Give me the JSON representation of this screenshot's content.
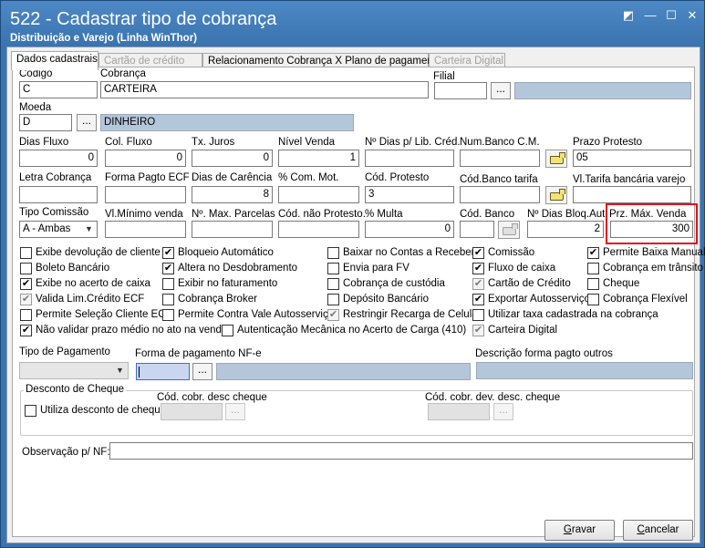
{
  "window": {
    "title": "522 - Cadastrar tipo de cobrança",
    "subtitle": "Distribuição e Varejo (Linha WinThor)"
  },
  "tabs": [
    {
      "label": "Dados cadastrais",
      "active": true
    },
    {
      "label": "Cartão de crédito",
      "enabled": false
    },
    {
      "label": "Relacionamento Cobrança X Plano de pagamento",
      "enabled": true
    },
    {
      "label": "Carteira Digital",
      "enabled": false
    }
  ],
  "fields": {
    "codigo": {
      "label": "Código",
      "value": "C"
    },
    "cobranca": {
      "label": "Cobrança",
      "value": "CARTEIRA"
    },
    "filial": {
      "label": "Filial",
      "value": "",
      "desc": ""
    },
    "moeda": {
      "label": "Moeda",
      "value": "D",
      "desc": "DINHEIRO"
    },
    "dias_fluxo": {
      "label": "Dias Fluxo",
      "value": "0"
    },
    "col_fluxo": {
      "label": "Col. Fluxo",
      "value": "0"
    },
    "tx_juros": {
      "label": "Tx. Juros",
      "value": "0"
    },
    "nivel_venda": {
      "label": "Nível Venda",
      "value": "1"
    },
    "nr_dias_lib": {
      "label": "Nº Dias p/ Lib. Créd.",
      "value": ""
    },
    "num_banco_cm": {
      "label": "Num.Banco C.M.",
      "value": ""
    },
    "prazo_protesto": {
      "label": "Prazo Protesto",
      "value": "05"
    },
    "letra_cobranca": {
      "label": "Letra Cobrança",
      "value": ""
    },
    "forma_pagto_ecf": {
      "label": "Forma Pagto ECF",
      "value": ""
    },
    "dias_carencia": {
      "label": "Dias de Carência",
      "value": "8"
    },
    "com_mot": {
      "label": "% Com. Mot.",
      "value": ""
    },
    "cod_protesto": {
      "label": "Cód. Protesto",
      "value": "3"
    },
    "cod_banco_tarifa": {
      "label": "Cód.Banco tarifa",
      "value": ""
    },
    "vl_tarifa": {
      "label": "Vl.Tarifa bancária varejo",
      "value": ""
    },
    "tipo_comissao": {
      "label": "Tipo Comissão",
      "value": "A - Ambas"
    },
    "vl_minimo_venda": {
      "label": "Vl.Mínimo venda",
      "value": ""
    },
    "nr_max_parcelas": {
      "label": "Nº. Max. Parcelas",
      "value": ""
    },
    "cod_nao_protesto": {
      "label": "Cód. não Protesto.",
      "value": ""
    },
    "multa": {
      "label": "% Multa",
      "value": "0"
    },
    "cod_banco": {
      "label": "Cód. Banco",
      "value": ""
    },
    "nr_dias_bloq": {
      "label": "Nº Dias Bloq.Aut.",
      "value": "2"
    },
    "prz_max_venda": {
      "label": "Prz. Máx. Venda",
      "value": "300"
    }
  },
  "checkboxes": {
    "exibe_devolucao": {
      "label": "Exibe devolução de cliente",
      "checked": false
    },
    "bloqueio_automatico": {
      "label": "Bloqueio Automático",
      "checked": true
    },
    "baixar_contas": {
      "label": "Baixar no Contas a Receber",
      "checked": false
    },
    "comissao": {
      "label": "Comissão",
      "checked": true
    },
    "permite_baixa_manual": {
      "label": "Permite Baixa Manual",
      "checked": true
    },
    "boleto_bancario": {
      "label": "Boleto Bancário",
      "checked": false
    },
    "altera_desdobramento": {
      "label": "Altera no Desdobramento",
      "checked": true
    },
    "envia_fv": {
      "label": "Envia para FV",
      "checked": false
    },
    "fluxo_caixa": {
      "label": "Fluxo de caixa",
      "checked": true
    },
    "cobranca_transito": {
      "label": "Cobrança em trânsito",
      "checked": false
    },
    "exibe_acerto_caixa": {
      "label": "Exibe no acerto de caixa",
      "checked": true
    },
    "exibir_faturamento": {
      "label": "Exibir no faturamento",
      "checked": false
    },
    "cobranca_custodia": {
      "label": "Cobrança de custódia",
      "checked": false
    },
    "cartao_credito": {
      "label": "Cartão de Crédito",
      "checked": true
    },
    "cheque": {
      "label": "Cheque",
      "checked": false
    },
    "valida_lim_credito": {
      "label": "Valida Lim.Crédito ECF",
      "checked": true
    },
    "cobranca_broker": {
      "label": "Cobrança Broker",
      "checked": false
    },
    "deposito_bancario": {
      "label": "Depósito Bancário",
      "checked": false
    },
    "exportar_autosservico": {
      "label": "Exportar Autosserviço",
      "checked": true
    },
    "cobranca_flexivel": {
      "label": "Cobrança Flexível",
      "checked": false
    },
    "permite_selecao_cliente": {
      "label": "Permite Seleção Cliente ECF",
      "checked": false
    },
    "permite_contra_vale": {
      "label": "Permite Contra Vale Autosserviço",
      "checked": false
    },
    "restringir_recarga": {
      "label": "Restringir Recarga de Celular",
      "checked": true
    },
    "utilizar_taxa": {
      "label": "Utilizar taxa cadastrada na cobrança",
      "checked": false
    },
    "nao_validar_prazo": {
      "label": "Não validar prazo médio no ato na venda",
      "checked": true
    },
    "autenticacao_mecanica": {
      "label": "Autenticação Mecânica no Acerto de Carga (410)",
      "checked": false
    },
    "carteira_digital": {
      "label": "Carteira Digital",
      "checked": true
    }
  },
  "pagamento": {
    "tipo_label": "Tipo de Pagamento",
    "tipo_value": "",
    "forma_label": "Forma de pagamento NF-e",
    "forma_value": "",
    "forma_desc": "",
    "descricao_label": "Descrição forma pagto outros",
    "descricao_value": ""
  },
  "desconto_cheque": {
    "group_title": "Desconto de Cheque",
    "utiliza_label": "Utiliza desconto de cheque",
    "utiliza_checked": false,
    "cod_desc_label": "Cód. cobr. desc cheque",
    "cod_desc_value": "",
    "cod_dev_label": "Cód. cobr. dev. desc. cheque",
    "cod_dev_value": ""
  },
  "observacao": {
    "label": "Observação p/ NF:",
    "value": ""
  },
  "buttons": {
    "gravar_pre": "",
    "gravar_key": "G",
    "gravar_post": "ravar",
    "cancelar_pre": "",
    "cancelar_key": "C",
    "cancelar_post": "ancelar"
  },
  "icons": {
    "ellipsis": "...",
    "combo_arrow": "▼",
    "check_mark": "✔",
    "restore_glyph": "◩",
    "minimize_glyph": "—",
    "maximize_glyph": "☐",
    "close_glyph": "✕"
  },
  "colors": {
    "titlebar": "#3a74b0",
    "readonly_field": "#b4c6d9",
    "highlight": "#e0141e"
  }
}
